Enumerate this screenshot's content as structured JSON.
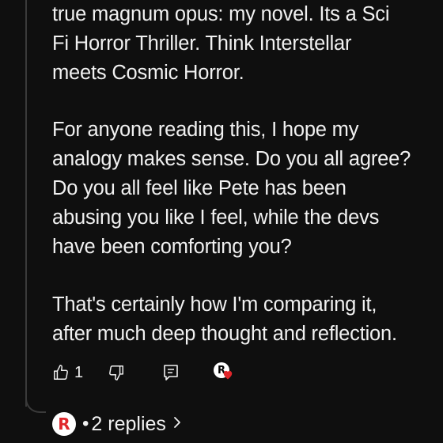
{
  "comment": {
    "paragraphs": [
      {
        "lines": [
          "true magnum opus: my novel. Its a Sci",
          "Fi Horror Thriller. Think Interstellar",
          "meets Cosmic Horror."
        ]
      },
      {
        "lines": [
          "For anyone reading this, I hope my",
          "analogy makes sense. Do you all agree?",
          "Do you all feel like Pete has been",
          "abusing you like I feel, while the devs",
          "have been comforting you?"
        ]
      },
      {
        "lines": [
          "That's certainly how I'm comparing it,",
          "after much deep thought and reflection."
        ]
      }
    ]
  },
  "actions": {
    "like_count": "1",
    "like_icon": "thumbs-up-icon",
    "dislike_icon": "thumbs-down-icon",
    "reply_icon": "reply-icon",
    "creator_heart_icon": "creator-heart-icon",
    "creator_avatar_letter": "R",
    "heart_color": "#e0262b"
  },
  "replies": {
    "avatar_letter": "R",
    "separator": "•",
    "label": "2 replies",
    "chevron_icon": "chevron-right-icon"
  },
  "colors": {
    "background": "#0f0f0f",
    "text": "#f1f1f1",
    "thread_line": "#3a3a3a"
  }
}
